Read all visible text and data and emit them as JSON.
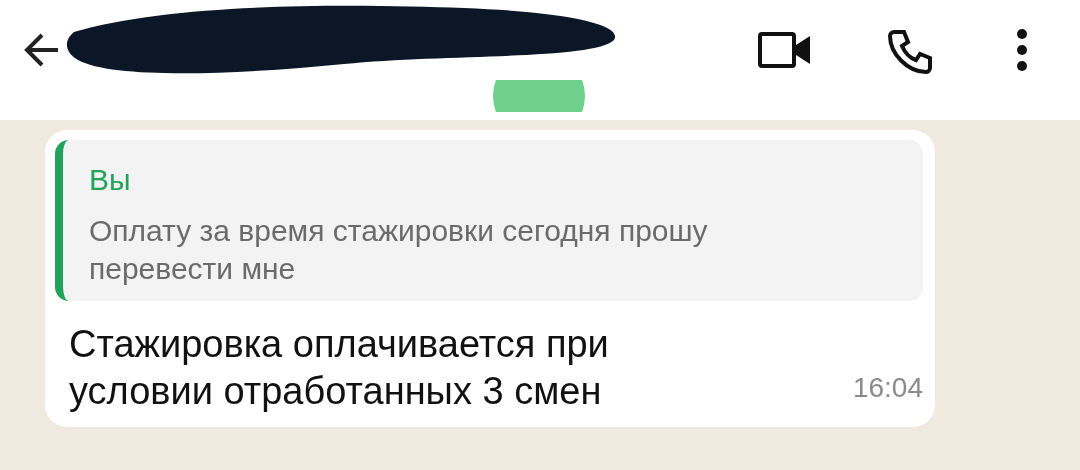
{
  "message": {
    "quote": {
      "sender": "Вы",
      "text": "Оплату за время стажировки сегодня прошу перевести мне"
    },
    "text": "Стажировка оплачивается при условии отработанных 3 смен",
    "time": "16:04"
  }
}
